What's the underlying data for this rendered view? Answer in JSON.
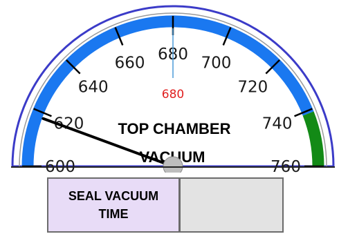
{
  "gauge": {
    "min": 600,
    "max": 760,
    "tick_labels": [
      "600",
      "620",
      "640",
      "660",
      "680",
      "700",
      "720",
      "740",
      "760"
    ],
    "tick_values": [
      600,
      620,
      640,
      660,
      680,
      700,
      720,
      740,
      760
    ],
    "setpoint_value": 680,
    "setpoint_label": "680",
    "needle_value": 618,
    "green_band_start": 741,
    "title_line1": "TOP CHAMBER",
    "title_line2": "VACUUM",
    "colors": {
      "scale_band": "#1a78f0",
      "good_band": "#138a16",
      "outer_border": "#3b3bc8",
      "setpoint_marker": "#4a9ad8",
      "setpoint_text": "#e02020",
      "needle": "#000000",
      "hub": "#bdbdbd"
    }
  },
  "seal_vacuum": {
    "label_line1": "SEAL VACUUM",
    "label_line2": "TIME",
    "value": ""
  }
}
